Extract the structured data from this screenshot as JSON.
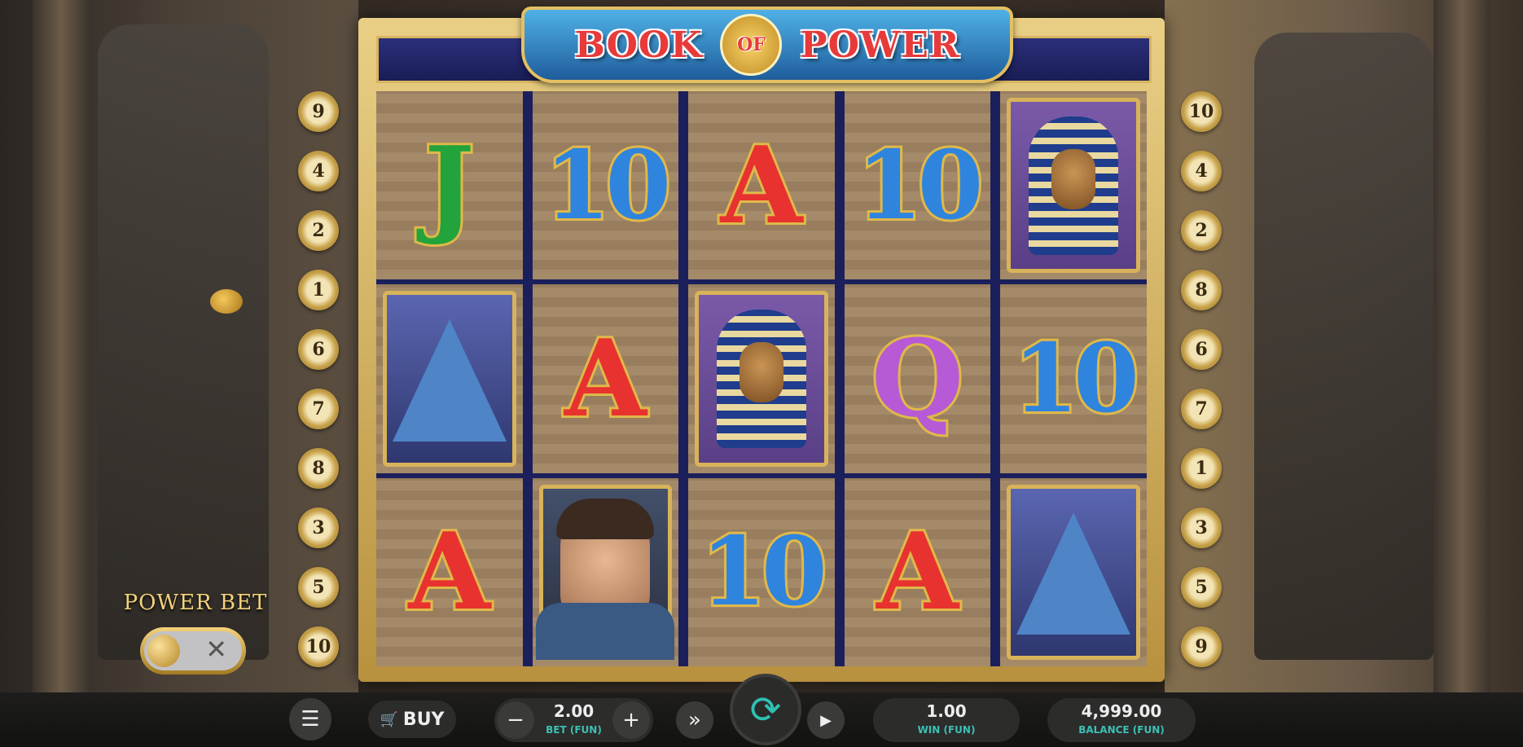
{
  "game": {
    "logo_left": "BOOK",
    "logo_of": "OF",
    "logo_right": "POWER"
  },
  "paylines": {
    "left": [
      "9",
      "4",
      "2",
      "1",
      "6",
      "7",
      "8",
      "3",
      "5",
      "10"
    ],
    "right": [
      "10",
      "4",
      "2",
      "8",
      "6",
      "7",
      "1",
      "3",
      "5",
      "9"
    ]
  },
  "reels": [
    [
      "J",
      "A-card-pyramid",
      "A"
    ],
    [
      "10",
      "A",
      "explorer"
    ],
    [
      "A",
      "pharaoh",
      "10"
    ],
    [
      "10",
      "Q",
      "A"
    ],
    [
      "pharaoh",
      "10",
      "pyramid"
    ]
  ],
  "power_bet": {
    "label": "POWER BET",
    "toggle_symbol": "✕",
    "enabled": false
  },
  "controls": {
    "menu_icon": "☰",
    "buy_label": "BUY",
    "bet_value": "2.00",
    "bet_label": "BET (FUN)",
    "win_value": "1.00",
    "win_label": "WIN (FUN)",
    "balance_value": "4,999.00",
    "balance_label": "BALANCE (FUN)",
    "minus": "−",
    "plus": "+",
    "fast_forward": "»",
    "spin_icon": "⟳",
    "play": "▶"
  }
}
